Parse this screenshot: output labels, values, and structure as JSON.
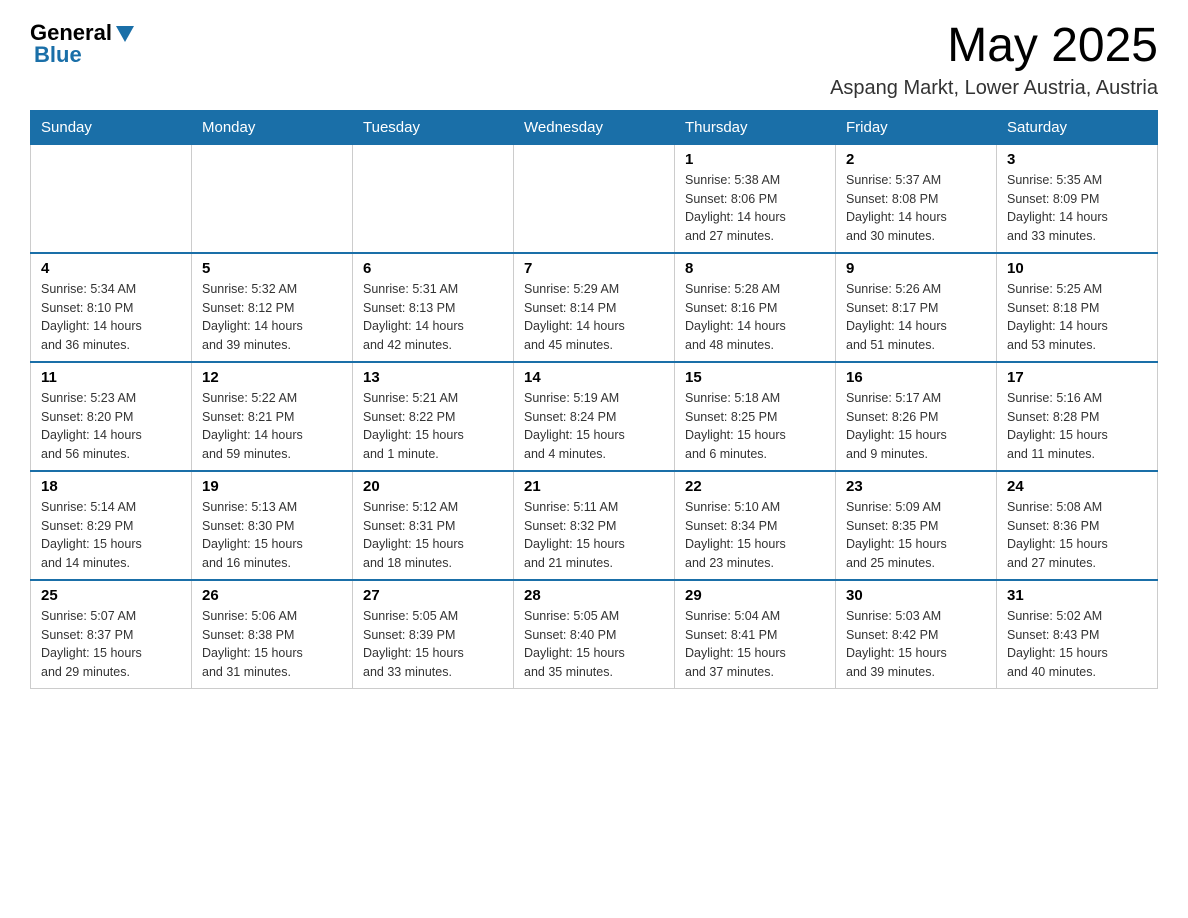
{
  "header": {
    "logo_general": "General",
    "logo_blue": "Blue",
    "month_title": "May 2025",
    "location": "Aspang Markt, Lower Austria, Austria"
  },
  "days_of_week": [
    "Sunday",
    "Monday",
    "Tuesday",
    "Wednesday",
    "Thursday",
    "Friday",
    "Saturday"
  ],
  "weeks": [
    [
      {
        "day": "",
        "info": ""
      },
      {
        "day": "",
        "info": ""
      },
      {
        "day": "",
        "info": ""
      },
      {
        "day": "",
        "info": ""
      },
      {
        "day": "1",
        "info": "Sunrise: 5:38 AM\nSunset: 8:06 PM\nDaylight: 14 hours\nand 27 minutes."
      },
      {
        "day": "2",
        "info": "Sunrise: 5:37 AM\nSunset: 8:08 PM\nDaylight: 14 hours\nand 30 minutes."
      },
      {
        "day": "3",
        "info": "Sunrise: 5:35 AM\nSunset: 8:09 PM\nDaylight: 14 hours\nand 33 minutes."
      }
    ],
    [
      {
        "day": "4",
        "info": "Sunrise: 5:34 AM\nSunset: 8:10 PM\nDaylight: 14 hours\nand 36 minutes."
      },
      {
        "day": "5",
        "info": "Sunrise: 5:32 AM\nSunset: 8:12 PM\nDaylight: 14 hours\nand 39 minutes."
      },
      {
        "day": "6",
        "info": "Sunrise: 5:31 AM\nSunset: 8:13 PM\nDaylight: 14 hours\nand 42 minutes."
      },
      {
        "day": "7",
        "info": "Sunrise: 5:29 AM\nSunset: 8:14 PM\nDaylight: 14 hours\nand 45 minutes."
      },
      {
        "day": "8",
        "info": "Sunrise: 5:28 AM\nSunset: 8:16 PM\nDaylight: 14 hours\nand 48 minutes."
      },
      {
        "day": "9",
        "info": "Sunrise: 5:26 AM\nSunset: 8:17 PM\nDaylight: 14 hours\nand 51 minutes."
      },
      {
        "day": "10",
        "info": "Sunrise: 5:25 AM\nSunset: 8:18 PM\nDaylight: 14 hours\nand 53 minutes."
      }
    ],
    [
      {
        "day": "11",
        "info": "Sunrise: 5:23 AM\nSunset: 8:20 PM\nDaylight: 14 hours\nand 56 minutes."
      },
      {
        "day": "12",
        "info": "Sunrise: 5:22 AM\nSunset: 8:21 PM\nDaylight: 14 hours\nand 59 minutes."
      },
      {
        "day": "13",
        "info": "Sunrise: 5:21 AM\nSunset: 8:22 PM\nDaylight: 15 hours\nand 1 minute."
      },
      {
        "day": "14",
        "info": "Sunrise: 5:19 AM\nSunset: 8:24 PM\nDaylight: 15 hours\nand 4 minutes."
      },
      {
        "day": "15",
        "info": "Sunrise: 5:18 AM\nSunset: 8:25 PM\nDaylight: 15 hours\nand 6 minutes."
      },
      {
        "day": "16",
        "info": "Sunrise: 5:17 AM\nSunset: 8:26 PM\nDaylight: 15 hours\nand 9 minutes."
      },
      {
        "day": "17",
        "info": "Sunrise: 5:16 AM\nSunset: 8:28 PM\nDaylight: 15 hours\nand 11 minutes."
      }
    ],
    [
      {
        "day": "18",
        "info": "Sunrise: 5:14 AM\nSunset: 8:29 PM\nDaylight: 15 hours\nand 14 minutes."
      },
      {
        "day": "19",
        "info": "Sunrise: 5:13 AM\nSunset: 8:30 PM\nDaylight: 15 hours\nand 16 minutes."
      },
      {
        "day": "20",
        "info": "Sunrise: 5:12 AM\nSunset: 8:31 PM\nDaylight: 15 hours\nand 18 minutes."
      },
      {
        "day": "21",
        "info": "Sunrise: 5:11 AM\nSunset: 8:32 PM\nDaylight: 15 hours\nand 21 minutes."
      },
      {
        "day": "22",
        "info": "Sunrise: 5:10 AM\nSunset: 8:34 PM\nDaylight: 15 hours\nand 23 minutes."
      },
      {
        "day": "23",
        "info": "Sunrise: 5:09 AM\nSunset: 8:35 PM\nDaylight: 15 hours\nand 25 minutes."
      },
      {
        "day": "24",
        "info": "Sunrise: 5:08 AM\nSunset: 8:36 PM\nDaylight: 15 hours\nand 27 minutes."
      }
    ],
    [
      {
        "day": "25",
        "info": "Sunrise: 5:07 AM\nSunset: 8:37 PM\nDaylight: 15 hours\nand 29 minutes."
      },
      {
        "day": "26",
        "info": "Sunrise: 5:06 AM\nSunset: 8:38 PM\nDaylight: 15 hours\nand 31 minutes."
      },
      {
        "day": "27",
        "info": "Sunrise: 5:05 AM\nSunset: 8:39 PM\nDaylight: 15 hours\nand 33 minutes."
      },
      {
        "day": "28",
        "info": "Sunrise: 5:05 AM\nSunset: 8:40 PM\nDaylight: 15 hours\nand 35 minutes."
      },
      {
        "day": "29",
        "info": "Sunrise: 5:04 AM\nSunset: 8:41 PM\nDaylight: 15 hours\nand 37 minutes."
      },
      {
        "day": "30",
        "info": "Sunrise: 5:03 AM\nSunset: 8:42 PM\nDaylight: 15 hours\nand 39 minutes."
      },
      {
        "day": "31",
        "info": "Sunrise: 5:02 AM\nSunset: 8:43 PM\nDaylight: 15 hours\nand 40 minutes."
      }
    ]
  ]
}
